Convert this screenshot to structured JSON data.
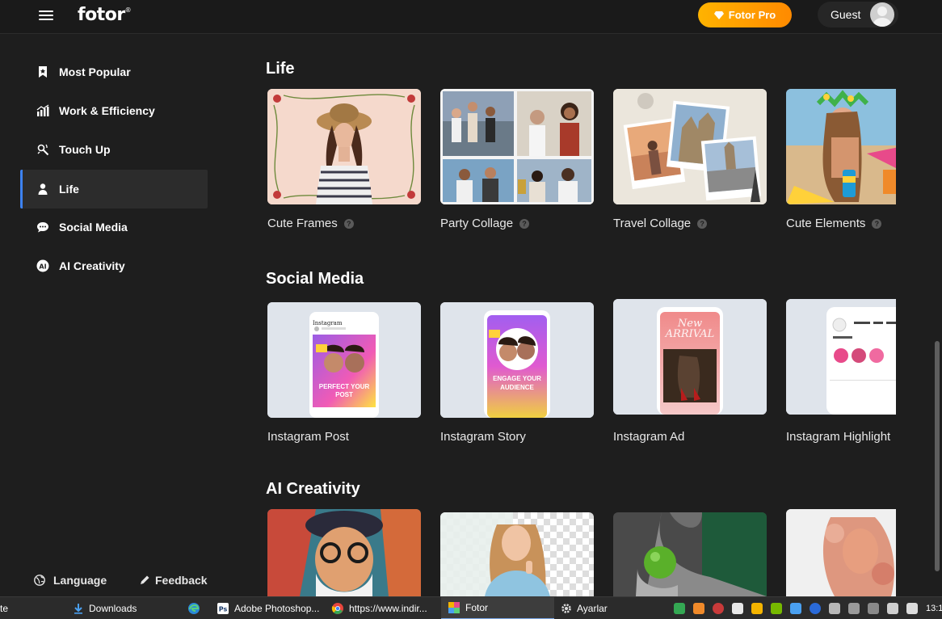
{
  "header": {
    "logo": "fotor",
    "logo_mark": "®",
    "pro_label": "Fotor Pro",
    "guest_label": "Guest"
  },
  "sidebar": {
    "items": [
      {
        "label": "Most Popular",
        "icon": "bookmark-star-icon"
      },
      {
        "label": "Work & Efficiency",
        "icon": "bar-chart-icon"
      },
      {
        "label": "Touch Up",
        "icon": "touch-up-icon"
      },
      {
        "label": "Life",
        "icon": "person-icon",
        "active": true
      },
      {
        "label": "Social Media",
        "icon": "chat-bubble-icon"
      },
      {
        "label": "AI Creativity",
        "icon": "ai-icon"
      }
    ],
    "language_label": "Language",
    "feedback_label": "Feedback"
  },
  "sections": [
    {
      "title": "Life",
      "cards": [
        {
          "label": "Cute Frames",
          "help": "?"
        },
        {
          "label": "Party Collage",
          "help": "?"
        },
        {
          "label": "Travel Collage",
          "help": "?"
        },
        {
          "label": "Cute Elements",
          "help": "?"
        }
      ]
    },
    {
      "title": "Social Media",
      "cards": [
        {
          "label": "Instagram Post",
          "text": "PERFECT YOUR POST",
          "brand": "Instagram"
        },
        {
          "label": "Instagram Story",
          "text": "ENGAGE YOUR AUDIENCE"
        },
        {
          "label": "Instagram Ad",
          "text": "New ARRIVAL"
        },
        {
          "label": "Instagram Highlight"
        }
      ]
    },
    {
      "title": "AI Creativity",
      "cards": [
        {},
        {},
        {},
        {}
      ]
    }
  ],
  "taskbar": {
    "items": [
      {
        "label": "te"
      },
      {
        "label": "Downloads",
        "icon": "download-arrow-icon"
      },
      {
        "label": "",
        "icon": "edge-icon"
      },
      {
        "label": "Adobe Photoshop...",
        "icon": "photoshop-icon"
      },
      {
        "label": "https://www.indir...",
        "icon": "chrome-icon"
      },
      {
        "label": "Fotor",
        "icon": "fotor-app-icon",
        "active": true
      },
      {
        "label": "Ayarlar",
        "icon": "gear-icon"
      }
    ],
    "clock": "13:1"
  },
  "colors": {
    "background": "#1e1e1e",
    "header": "#1a1a1a",
    "accent": "#3d82f0",
    "pro_start": "#ffb300",
    "pro_end": "#ff8a00"
  }
}
